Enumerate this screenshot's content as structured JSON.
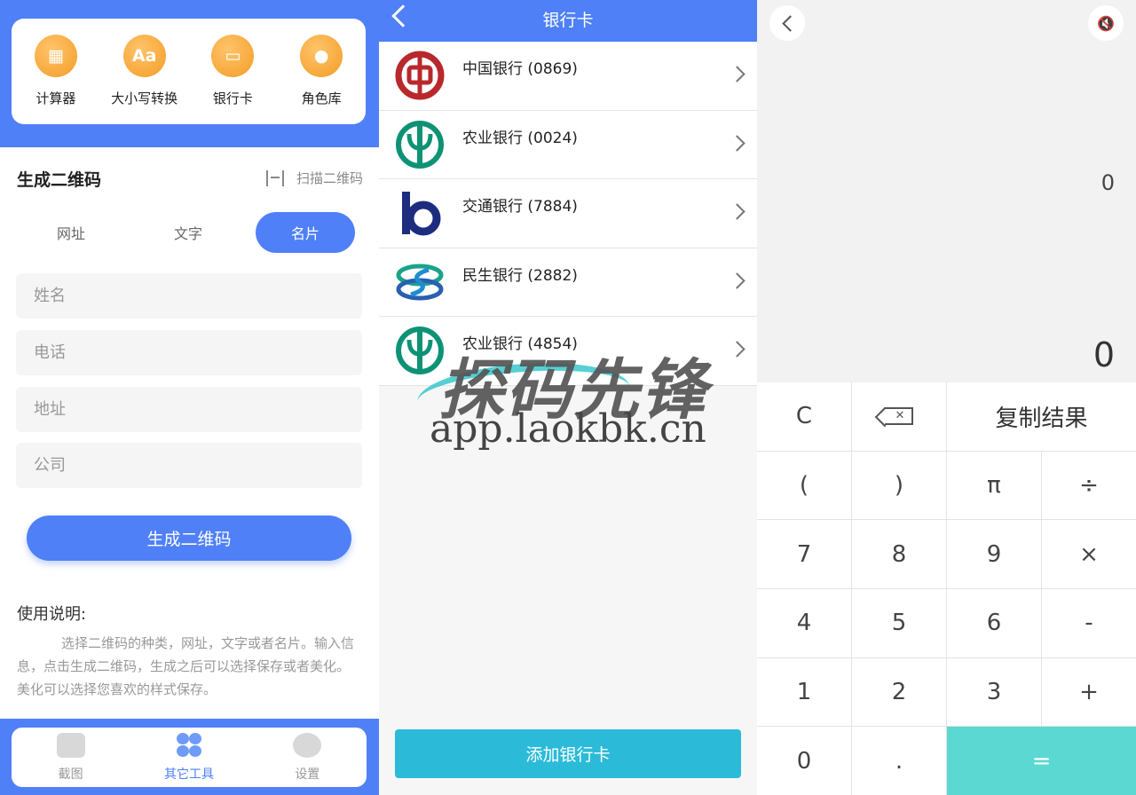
{
  "left": {
    "tools": [
      {
        "label": "计算器",
        "icon": "calculator-icon"
      },
      {
        "label": "大小写转换",
        "icon": "case-convert-icon"
      },
      {
        "label": "银行卡",
        "icon": "bank-card-icon"
      },
      {
        "label": "角色库",
        "icon": "role-library-icon"
      }
    ],
    "qr_title": "生成二维码",
    "scan_label": "扫描二维码",
    "tabs": [
      "网址",
      "文字",
      "名片"
    ],
    "fields": {
      "name_placeholder": "姓名",
      "phone_placeholder": "电话",
      "address_placeholder": "地址",
      "company_placeholder": "公司"
    },
    "generate_label": "生成二维码",
    "usage_title": "使用说明:",
    "usage_text": "选择二维码的种类，网址，文字或者名片。输入信息，点击生成二维码，生成之后可以选择保存或者美化。美化可以选择您喜欢的样式保存。",
    "nav": [
      "截图",
      "其它工具",
      "设置"
    ]
  },
  "mid": {
    "title": "银行卡",
    "banks": [
      {
        "name": "中国银行 (0869)"
      },
      {
        "name": "农业银行 (0024)"
      },
      {
        "name": "交通银行 (7884)"
      },
      {
        "name": "民生银行 (2882)"
      },
      {
        "name": "农业银行 (4854)"
      }
    ],
    "add_label": "添加银行卡"
  },
  "calc": {
    "expression": "0",
    "result": "0",
    "keys": {
      "clear": "C",
      "copy": "复制结果",
      "lparen": "(",
      "rparen": ")",
      "pi": "π",
      "divide": "÷",
      "seven": "7",
      "eight": "8",
      "nine": "9",
      "multiply": "×",
      "four": "4",
      "five": "5",
      "six": "6",
      "minus": "-",
      "one": "1",
      "two": "2",
      "three": "3",
      "plus": "+",
      "zero": "0",
      "dot": ".",
      "equals": "="
    }
  },
  "watermark": {
    "text": "探码先锋",
    "url": "app.laokbk.cn"
  },
  "colors": {
    "primary_blue": "#4f80f8",
    "add_button": "#2bbbd9",
    "equals_key": "#5bd8d2",
    "tool_orange": "#f39c25"
  }
}
